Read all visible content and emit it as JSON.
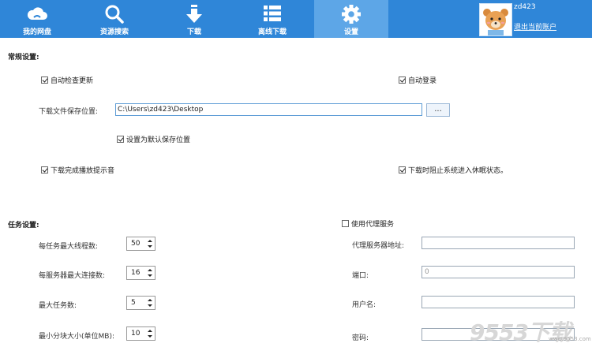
{
  "nav": {
    "items": [
      {
        "label": "我的网盘",
        "icon": "cloud-icon"
      },
      {
        "label": "资源搜索",
        "icon": "search-icon"
      },
      {
        "label": "下载",
        "icon": "download-arrow-icon"
      },
      {
        "label": "离线下载",
        "icon": "list-icon"
      },
      {
        "label": "设置",
        "icon": "gear-icon",
        "active": true
      }
    ]
  },
  "user": {
    "name": "zd423",
    "logout": "退出当前账户"
  },
  "general": {
    "title": "常规设置:",
    "auto_update": "自动检查更新",
    "auto_login": "自动登录",
    "save_path_label": "下载文件保存位置:",
    "save_path_value": "C:\\Users\\zd423\\Desktop",
    "browse_label": "...",
    "set_default": "设置为默认保存位置",
    "play_sound": "下载完成播放提示音",
    "prevent_sleep": "下载时阻止系统进入休眠状态。"
  },
  "task": {
    "title": "任务设置:",
    "rows": [
      {
        "label": "每任务最大线程数:",
        "value": "50"
      },
      {
        "label": "每服务器最大连接数:",
        "value": "16"
      },
      {
        "label": "最大任务数:",
        "value": "5"
      },
      {
        "label": "最小分块大小(单位MB):",
        "value": "10"
      }
    ]
  },
  "proxy": {
    "enable": "使用代理服务",
    "server_label": "代理服务器地址:",
    "server_value": "",
    "port_label": "端口:",
    "port_value": "0",
    "user_label": "用户名:",
    "user_value": "",
    "password_label": "密码:",
    "password_value": ""
  },
  "watermark": {
    "text": "9553下载",
    "site": "www.9553.com"
  },
  "colors": {
    "nav_bg": "#2f86d8",
    "nav_active": "#5da6e7"
  }
}
